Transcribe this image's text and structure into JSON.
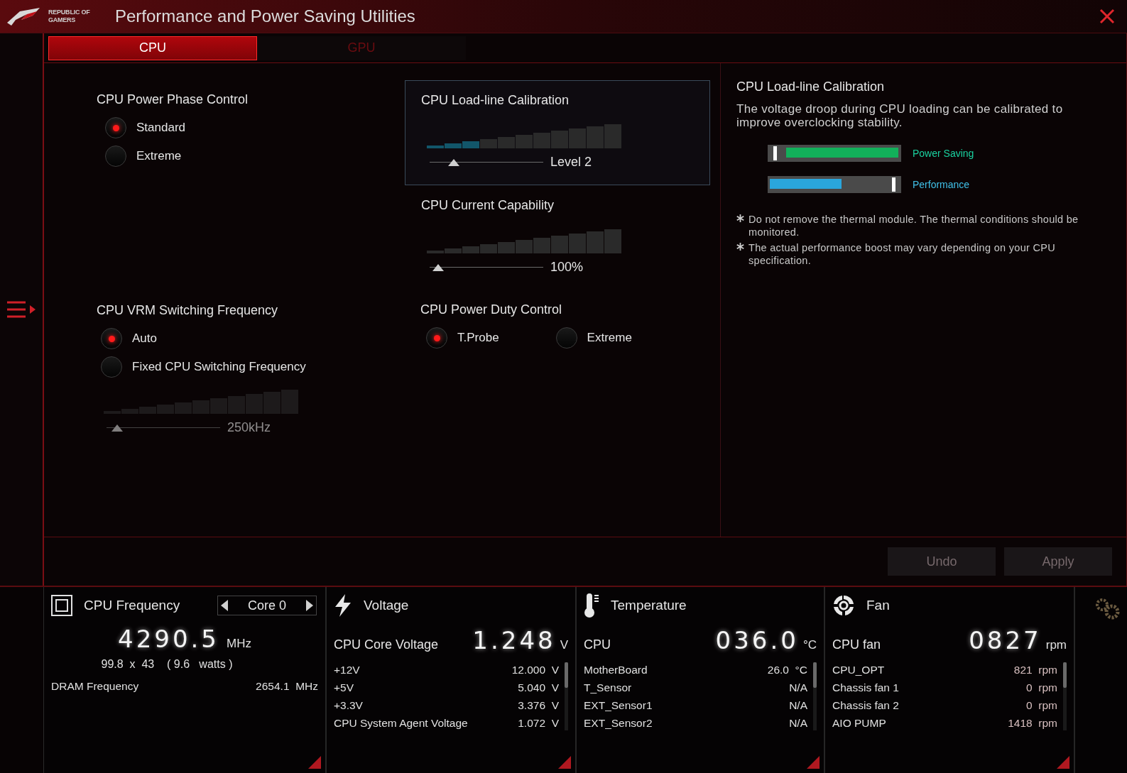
{
  "window": {
    "logo_lines": [
      "REPUBLIC OF",
      "GAMERS"
    ],
    "title": "Performance and Power Saving Utilities"
  },
  "tabs": [
    {
      "label": "CPU",
      "selected": true
    },
    {
      "label": "GPU",
      "selected": false
    }
  ],
  "left_column": [
    {
      "kind": "radio_group",
      "title": "CPU Power Phase Control",
      "options": [
        {
          "label": "Standard",
          "selected": true
        },
        {
          "label": "Extreme",
          "selected": false
        }
      ]
    },
    {
      "kind": "radio_group",
      "title": "CPU VRM Switching Frequency",
      "options": [
        {
          "label": "Auto",
          "selected": true
        },
        {
          "label": "Fixed CPU Switching Frequency",
          "selected": false
        }
      ],
      "slider": {
        "level": 0.05,
        "reading": "250kHz",
        "disabled": true
      }
    }
  ],
  "middle_column": [
    {
      "kind": "slider",
      "title": "CPU Load-line Calibration",
      "highlighted": true,
      "level": 0.18,
      "reading": "Level 2"
    },
    {
      "kind": "slider",
      "title": "CPU Current Capability",
      "highlighted": false,
      "level": 0.03,
      "reading": "100%"
    },
    {
      "kind": "radio_row",
      "title": "CPU Power Duty Control",
      "options": [
        {
          "label": "T.Probe",
          "selected": true
        },
        {
          "label": "Extreme",
          "selected": false
        }
      ]
    }
  ],
  "info": {
    "title": "CPU Load-line Calibration",
    "description": "The voltage droop during CPU loading can be calibrated to improve overclocking stability.",
    "legend": [
      {
        "kind": "saving",
        "label": "Power Saving"
      },
      {
        "kind": "performance",
        "label": "Performance"
      }
    ],
    "notes": [
      "Do not remove the thermal module. The thermal conditions should be monitored.",
      "The actual performance boost may vary depending on your CPU specification."
    ]
  },
  "buttons": [
    {
      "label": "Undo",
      "disabled": true
    },
    {
      "label": "Apply",
      "disabled": true
    }
  ],
  "monitor": [
    {
      "kind": "frequency",
      "title": "CPU Frequency",
      "selector": "Core 0",
      "reading": "4290.5",
      "unit": "MHz",
      "detail": "99.8  x  43    ( 9.6   watts )",
      "rows": [
        {
          "label": "DRAM Frequency",
          "value": "2654.1",
          "unit": "MHz"
        }
      ]
    },
    {
      "kind": "voltage",
      "title": "Voltage",
      "main_label": "CPU Core Voltage",
      "reading": "1.248",
      "unit": "V",
      "rows": [
        {
          "label": "+12V",
          "value": "12.000",
          "unit": "V"
        },
        {
          "label": "+5V",
          "value": "5.040",
          "unit": "V"
        },
        {
          "label": "+3.3V",
          "value": "3.376",
          "unit": "V"
        },
        {
          "label": "CPU System Agent Voltage",
          "value": "1.072",
          "unit": "V"
        }
      ]
    },
    {
      "kind": "temperature",
      "title": "Temperature",
      "main_label": "CPU",
      "reading": "036.0",
      "unit": "°C",
      "rows": [
        {
          "label": "MotherBoard",
          "value": "26.0",
          "unit": "°C"
        },
        {
          "label": "T_Sensor",
          "value": "N/A"
        },
        {
          "label": "EXT_Sensor1",
          "value": "N/A"
        },
        {
          "label": "EXT_Sensor2",
          "value": "N/A"
        }
      ]
    },
    {
      "kind": "fan",
      "title": "Fan",
      "main_label": "CPU fan",
      "reading": "0827",
      "unit": "rpm",
      "rows": [
        {
          "label": "CPU_OPT",
          "value": "821",
          "unit": "rpm"
        },
        {
          "label": "Chassis fan 1",
          "value": "0",
          "unit": "rpm"
        },
        {
          "label": "Chassis fan 2",
          "value": "0",
          "unit": "rpm"
        },
        {
          "label": "AIO PUMP",
          "value": "1418",
          "unit": "rpm"
        }
      ]
    }
  ]
}
